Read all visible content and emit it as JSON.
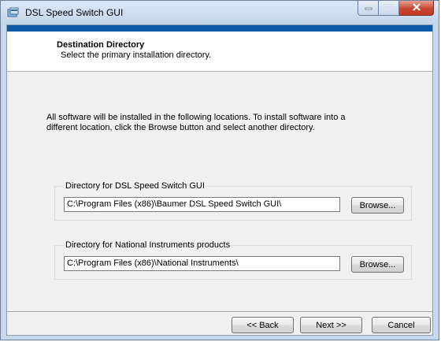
{
  "window": {
    "title": "DSL Speed Switch GUI",
    "icons": {
      "app": "installer-app-icon",
      "minimize": "minimize-icon",
      "maximize": "maximize-icon",
      "close": "close-icon"
    },
    "accent_color": "#0c5aa5"
  },
  "banner": {
    "title": "Destination Directory",
    "subtitle": "Select the primary installation directory."
  },
  "intro": {
    "line1": "All software will be installed in the following locations. To install software into a",
    "line2": "different location, click the Browse button and select another directory."
  },
  "directories": [
    {
      "label": "Directory for DSL Speed Switch GUI",
      "path": "C:\\Program Files (x86)\\Baumer DSL Speed Switch GUI\\",
      "browse_label": "Browse..."
    },
    {
      "label": "Directory for National Instruments products",
      "path": "C:\\Program Files (x86)\\National Instruments\\",
      "browse_label": "Browse..."
    }
  ],
  "footer": {
    "back_label": "<< Back",
    "next_label": "Next >>",
    "cancel_label": "Cancel"
  }
}
